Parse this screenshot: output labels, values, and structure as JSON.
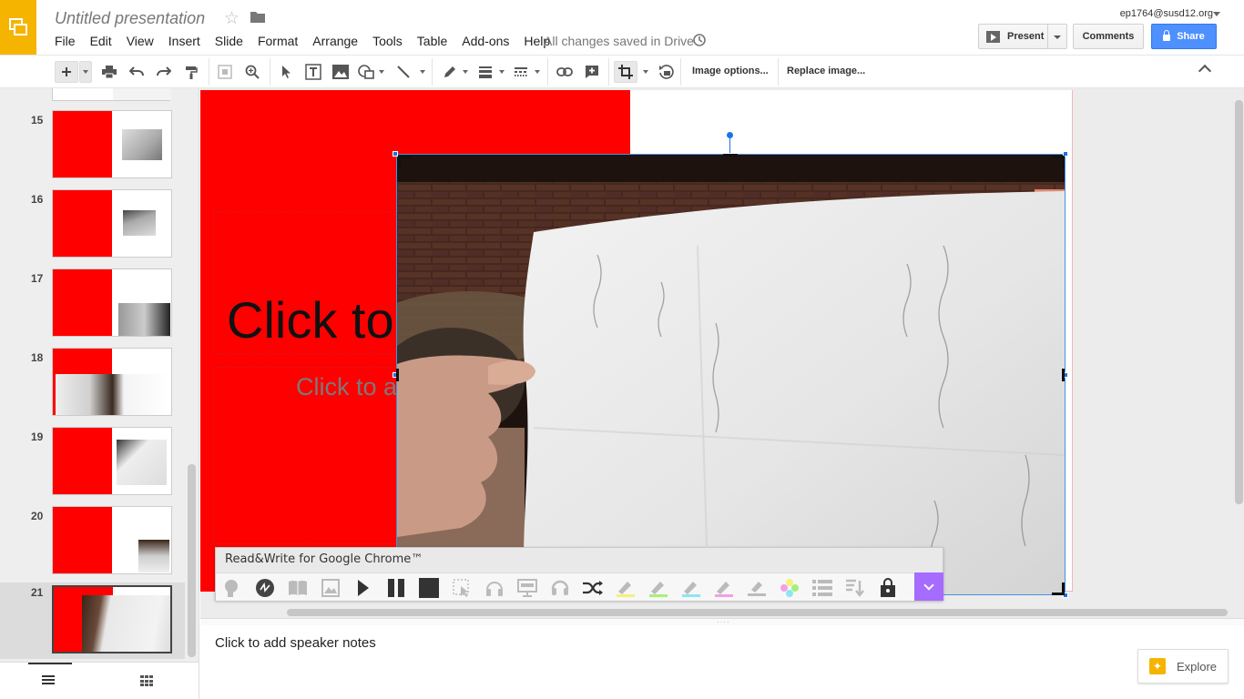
{
  "app": {
    "title": "Untitled presentation",
    "saved_status": "All changes saved in Drive",
    "account": "ep1764@susd12.org"
  },
  "menu": [
    "File",
    "Edit",
    "View",
    "Insert",
    "Slide",
    "Format",
    "Arrange",
    "Tools",
    "Table",
    "Add-ons",
    "Help"
  ],
  "header_buttons": {
    "present": "Present",
    "comments": "Comments",
    "share": "Share"
  },
  "toolbar": {
    "image_options": "Image options...",
    "replace_image": "Replace image..."
  },
  "filmstrip": {
    "slides": [
      "15",
      "16",
      "17",
      "18",
      "19",
      "20",
      "21"
    ],
    "selected": "21"
  },
  "slide": {
    "title_placeholder": "Click to",
    "subtitle_placeholder": "Click to a",
    "accent_color": "#ff0000"
  },
  "readwrite": {
    "title": "Read&Write for Google Chrome™",
    "accent_color": "#a66bff",
    "tools": [
      "text-to-speech-icon",
      "talking-dictionary-icon",
      "dictionary-icon",
      "picture-dictionary-icon",
      "play-icon",
      "pause-icon",
      "stop-icon",
      "screenshot-reader-icon",
      "audio-maker-icon",
      "screen-mask-icon",
      "speech-input-icon",
      "translator-icon",
      "highlight-yellow-icon",
      "highlight-green-icon",
      "highlight-blue-icon",
      "highlight-pink-icon",
      "clear-highlights-icon",
      "collect-highlights-icon",
      "vocabulary-list-icon",
      "check-it-icon",
      "voice-note-icon"
    ]
  },
  "notes": {
    "placeholder": "Click to add speaker notes"
  },
  "explore": {
    "label": "Explore"
  }
}
